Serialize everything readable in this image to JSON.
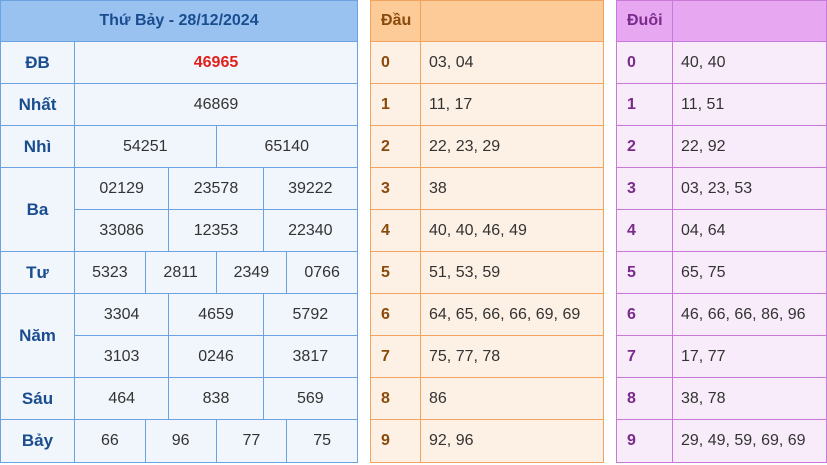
{
  "results": {
    "title": "Thứ Bảy - 28/12/2024",
    "prizes": [
      {
        "label": "ĐB",
        "rows": [
          [
            "46965"
          ]
        ],
        "highlight": true
      },
      {
        "label": "Nhất",
        "rows": [
          [
            "46869"
          ]
        ]
      },
      {
        "label": "Nhì",
        "rows": [
          [
            "54251",
            "65140"
          ]
        ]
      },
      {
        "label": "Ba",
        "rows": [
          [
            "02129",
            "23578",
            "39222"
          ],
          [
            "33086",
            "12353",
            "22340"
          ]
        ]
      },
      {
        "label": "Tư",
        "rows": [
          [
            "5323",
            "2811",
            "2349",
            "0766"
          ]
        ]
      },
      {
        "label": "Năm",
        "rows": [
          [
            "3304",
            "4659",
            "5792"
          ],
          [
            "3103",
            "0246",
            "3817"
          ]
        ]
      },
      {
        "label": "Sáu",
        "rows": [
          [
            "464",
            "838",
            "569"
          ]
        ]
      },
      {
        "label": "Bảy",
        "rows": [
          [
            "66",
            "96",
            "77",
            "75"
          ]
        ]
      }
    ]
  },
  "dau": {
    "header": "Đầu",
    "rows": [
      {
        "k": "0",
        "v": "03, 04"
      },
      {
        "k": "1",
        "v": "11, 17"
      },
      {
        "k": "2",
        "v": "22, 23, 29"
      },
      {
        "k": "3",
        "v": "38"
      },
      {
        "k": "4",
        "v": "40, 40, 46, 49"
      },
      {
        "k": "5",
        "v": "51, 53, 59"
      },
      {
        "k": "6",
        "v": "64, 65, 66, 66, 69, 69"
      },
      {
        "k": "7",
        "v": "75, 77, 78"
      },
      {
        "k": "8",
        "v": "86"
      },
      {
        "k": "9",
        "v": "92, 96"
      }
    ]
  },
  "duoi": {
    "header": "Đuôi",
    "rows": [
      {
        "k": "0",
        "v": "40, 40"
      },
      {
        "k": "1",
        "v": "11, 51"
      },
      {
        "k": "2",
        "v": "22, 92"
      },
      {
        "k": "3",
        "v": "03, 23, 53"
      },
      {
        "k": "4",
        "v": "04, 64"
      },
      {
        "k": "5",
        "v": "65, 75"
      },
      {
        "k": "6",
        "v": "46, 66, 66, 86, 96"
      },
      {
        "k": "7",
        "v": "17, 77"
      },
      {
        "k": "8",
        "v": "38, 78"
      },
      {
        "k": "9",
        "v": "29, 49, 59, 69, 69"
      }
    ]
  }
}
